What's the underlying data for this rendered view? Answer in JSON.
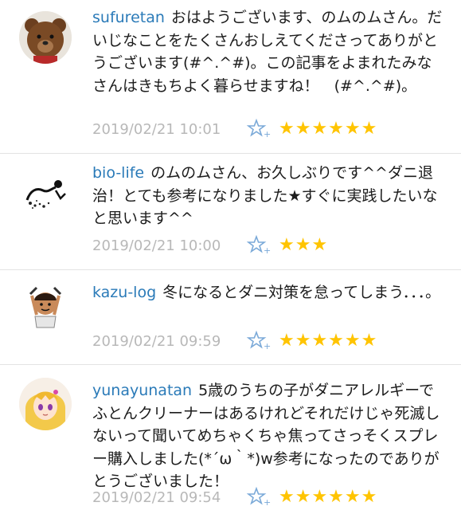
{
  "comments": [
    {
      "avatar": "teddy-bear-avatar",
      "username": "sufuretan",
      "text": "おはようございます、のムのムさん。だいじなことをたくさんおしえてくださってありがとうございます(#^.^#)。この記事をよまれたみなさんはきもちよく暮らせますね！　(#^.^#)。",
      "timestamp": "2019/02/21 10:01",
      "rating": 6,
      "rating_text": "★★★★★★"
    },
    {
      "avatar": "ink-drawing-avatar",
      "username": "bio-life",
      "text": "のムのムさん、お久しぶりです^^ダニ退治！とても参考になりました★すぐに実践したいなと思います^^",
      "timestamp": "2019/02/21 10:00",
      "rating": 3,
      "rating_text": "★★★"
    },
    {
      "avatar": "cartoon-boy-avatar",
      "username": "kazu-log",
      "text": "冬になるとダニ対策を怠ってしまう．．．。",
      "timestamp": "2019/02/21 09:59",
      "rating": 6,
      "rating_text": "★★★★★★"
    },
    {
      "avatar": "anime-girl-avatar",
      "username": "yunayunatan",
      "text": "5歳のうちの子がダニアレルギーでふとんクリーナーはあるけれどそれだけじゃ死滅しないって聞いてめちゃくちゃ焦ってさっそくスプレー購入しました(*´ω｀*)w参考になったのでありがとうございました！",
      "timestamp": "2019/02/21 09:54",
      "rating": 6,
      "rating_text": "★★★★★★"
    }
  ],
  "colors": {
    "username": "#2a7ab8",
    "timestamp": "#b8b8b8",
    "star": "#ffc400",
    "fav_icon": "#7aa9d8"
  }
}
